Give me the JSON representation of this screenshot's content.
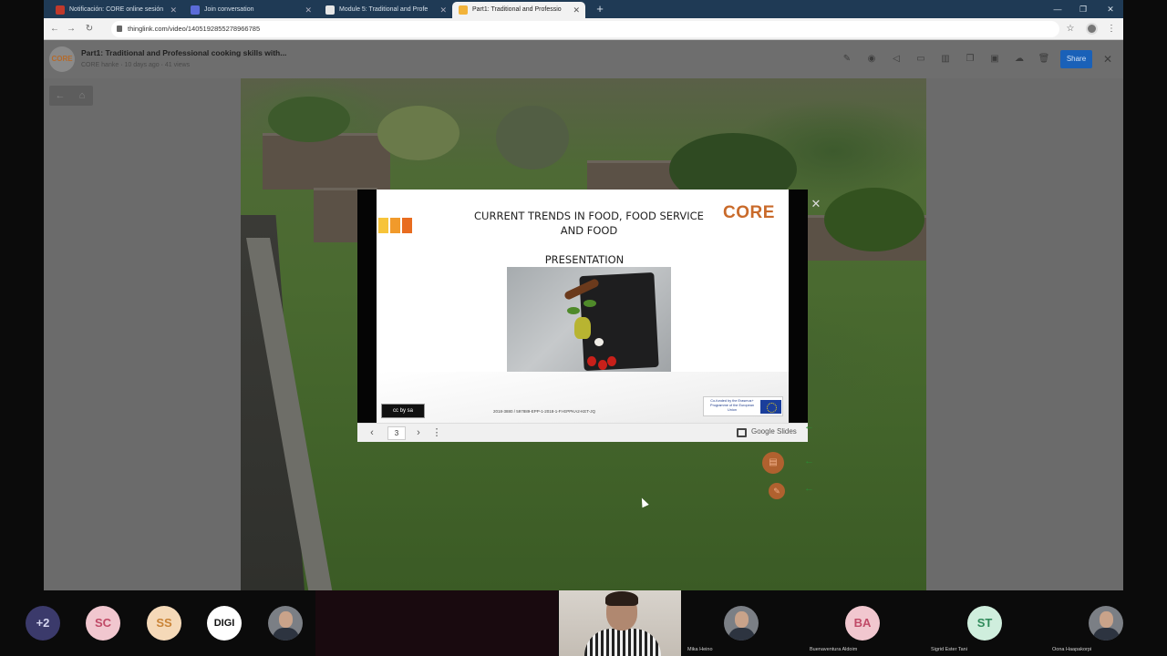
{
  "browser": {
    "tabs": [
      {
        "label": "Notificación: CORE online sesión",
        "favicon_color": "#c0392b"
      },
      {
        "label": "Join conversation",
        "favicon_color": "#5b6bd8"
      },
      {
        "label": "Module 5: Traditional and Profe",
        "favicon_color": "#e6e6e6"
      },
      {
        "label": "Part1: Traditional and Professio",
        "favicon_color": "#f2b33a",
        "active": true
      }
    ],
    "new_tab": "+",
    "url": "thinglink.com/video/1405192855278966785"
  },
  "thinglink": {
    "logo": "CORE",
    "title": "Part1: Traditional and Professional cooking skills with...",
    "author": "CORE hanke",
    "age": "10 days ago",
    "views": "41 views",
    "share_label": "Share"
  },
  "slide": {
    "title": "CURRENT TRENDS IN FOOD, FOOD SERVICE AND FOOD",
    "subtitle": "PRESENTATION",
    "logo": "CORE",
    "reference": "2018-3880 / 597889-EPP-1-2018-1-FI-EPPKA2-KET-JQ",
    "eu_text": "Co-funded by the Erasmus+ Programme of the European Union",
    "license": "cc by sa",
    "bar_colors": [
      "#f7c43a",
      "#f19a2b",
      "#e86c1f"
    ]
  },
  "slides_bar": {
    "page": "3",
    "label": "Google Slides"
  },
  "participants": [
    {
      "initials": "+2",
      "bg": "#3b3a6b",
      "fg": "#d6d6f0"
    },
    {
      "initials": "SC",
      "bg": "#f1c7cf",
      "fg": "#c04a67"
    },
    {
      "initials": "SS",
      "bg": "#f5d9b8",
      "fg": "#c98336"
    },
    {
      "initials": "DIGI",
      "bg": "#ffffff",
      "fg": "#111111"
    },
    {
      "name": "Mika Heino"
    },
    {
      "initials": "BA",
      "bg": "#f1c7cf",
      "fg": "#c04a67",
      "name": "Buenaventura Aldoim"
    },
    {
      "initials": "ST",
      "bg": "#cfeedd",
      "fg": "#2f8a5a",
      "name": "Sigrid Ester Tani"
    },
    {
      "name": "Oona Haapakorpi"
    }
  ]
}
